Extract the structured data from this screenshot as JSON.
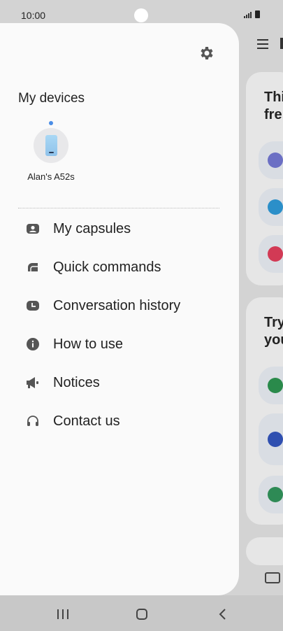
{
  "status_bar": {
    "time": "10:00",
    "icons": [
      "signal-icon",
      "battery-icon"
    ]
  },
  "drawer": {
    "settings_icon": "gear-icon",
    "section_title": "My devices",
    "device": {
      "name": "Alan's A52s",
      "icon": "phone-icon",
      "status_color": "#4a8de6"
    },
    "menu": [
      {
        "label": "My capsules",
        "icon": "capsules-icon"
      },
      {
        "label": "Quick commands",
        "icon": "quick-commands-icon"
      },
      {
        "label": "Conversation history",
        "icon": "history-icon"
      },
      {
        "label": "How to use",
        "icon": "info-icon"
      },
      {
        "label": "Notices",
        "icon": "megaphone-icon"
      },
      {
        "label": "Contact us",
        "icon": "headset-icon"
      }
    ]
  },
  "background_app": {
    "card1_title": "Thi\nfre",
    "card2_title": "Try\nyou"
  },
  "nav_bar": {
    "buttons": [
      "recent-apps",
      "home",
      "back"
    ]
  },
  "colors": {
    "drawer_bg": "#fafafa",
    "accent": "#4a8de6",
    "scrim": "#d3d3d3"
  }
}
